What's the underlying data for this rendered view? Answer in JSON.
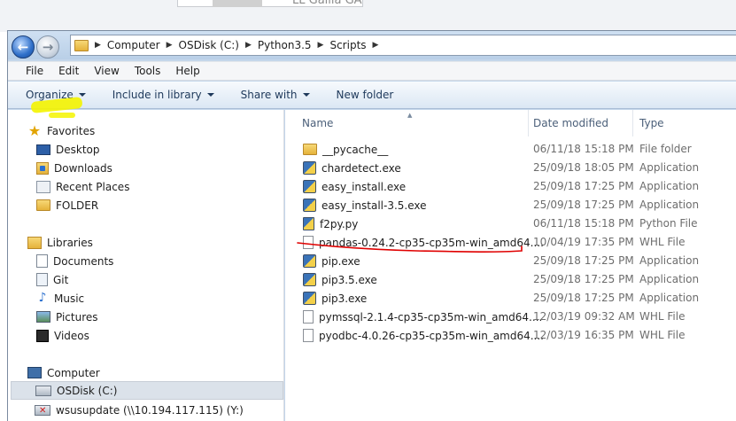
{
  "background": {
    "partial_text": "LL Gallia GA"
  },
  "address_bar": {
    "crumbs": [
      "Computer",
      "OSDisk (C:)",
      "Python3.5",
      "Scripts"
    ]
  },
  "menu": {
    "items": [
      "File",
      "Edit",
      "View",
      "Tools",
      "Help"
    ]
  },
  "commands": {
    "organize": "Organize",
    "include_in_library": "Include in library",
    "share_with": "Share with",
    "new_folder": "New folder"
  },
  "nav": {
    "favorites": {
      "label": "Favorites",
      "items": [
        "Desktop",
        "Downloads",
        "Recent Places",
        "FOLDER"
      ]
    },
    "libraries": {
      "label": "Libraries",
      "items": [
        "Documents",
        "Git",
        "Music",
        "Pictures",
        "Videos"
      ]
    },
    "computer": {
      "label": "Computer",
      "items": [
        "OSDisk (C:)",
        "wsusupdate (\\\\10.194.117.115) (Y:)"
      ]
    }
  },
  "columns": {
    "name": "Name",
    "date_modified": "Date modified",
    "type": "Type"
  },
  "files": [
    {
      "name": "__pycache__",
      "date": "06/11/18 15:18 PM",
      "type": "File folder",
      "icon": "folder-icon"
    },
    {
      "name": "chardetect.exe",
      "date": "25/09/18 18:05 PM",
      "type": "Application",
      "icon": "python-exe-icon"
    },
    {
      "name": "easy_install.exe",
      "date": "25/09/18 17:25 PM",
      "type": "Application",
      "icon": "python-exe-icon"
    },
    {
      "name": "easy_install-3.5.exe",
      "date": "25/09/18 17:25 PM",
      "type": "Application",
      "icon": "python-exe-icon"
    },
    {
      "name": "f2py.py",
      "date": "06/11/18 15:18 PM",
      "type": "Python File",
      "icon": "python-file-icon"
    },
    {
      "name": "pandas-0.24.2-cp35-cp35m-win_amd64....",
      "date": "10/04/19 17:35 PM",
      "type": "WHL File",
      "icon": "whl-file-icon"
    },
    {
      "name": "pip.exe",
      "date": "25/09/18 17:25 PM",
      "type": "Application",
      "icon": "python-exe-icon"
    },
    {
      "name": "pip3.5.exe",
      "date": "25/09/18 17:25 PM",
      "type": "Application",
      "icon": "python-exe-icon"
    },
    {
      "name": "pip3.exe",
      "date": "25/09/18 17:25 PM",
      "type": "Application",
      "icon": "python-exe-icon"
    },
    {
      "name": "pymssql-2.1.4-cp35-cp35m-win_amd64....",
      "date": "12/03/19 09:32 AM",
      "type": "WHL File",
      "icon": "whl-file-icon"
    },
    {
      "name": "pyodbc-4.0.26-cp35-cp35m-win_amd64....",
      "date": "12/03/19 16:35 PM",
      "type": "WHL File",
      "icon": "whl-file-icon"
    }
  ],
  "colors": {
    "accent": "#1e395b",
    "annotation_underline": "#e00000",
    "annotation_highlight": "#f4f400",
    "selection": "#dbe2ea"
  }
}
